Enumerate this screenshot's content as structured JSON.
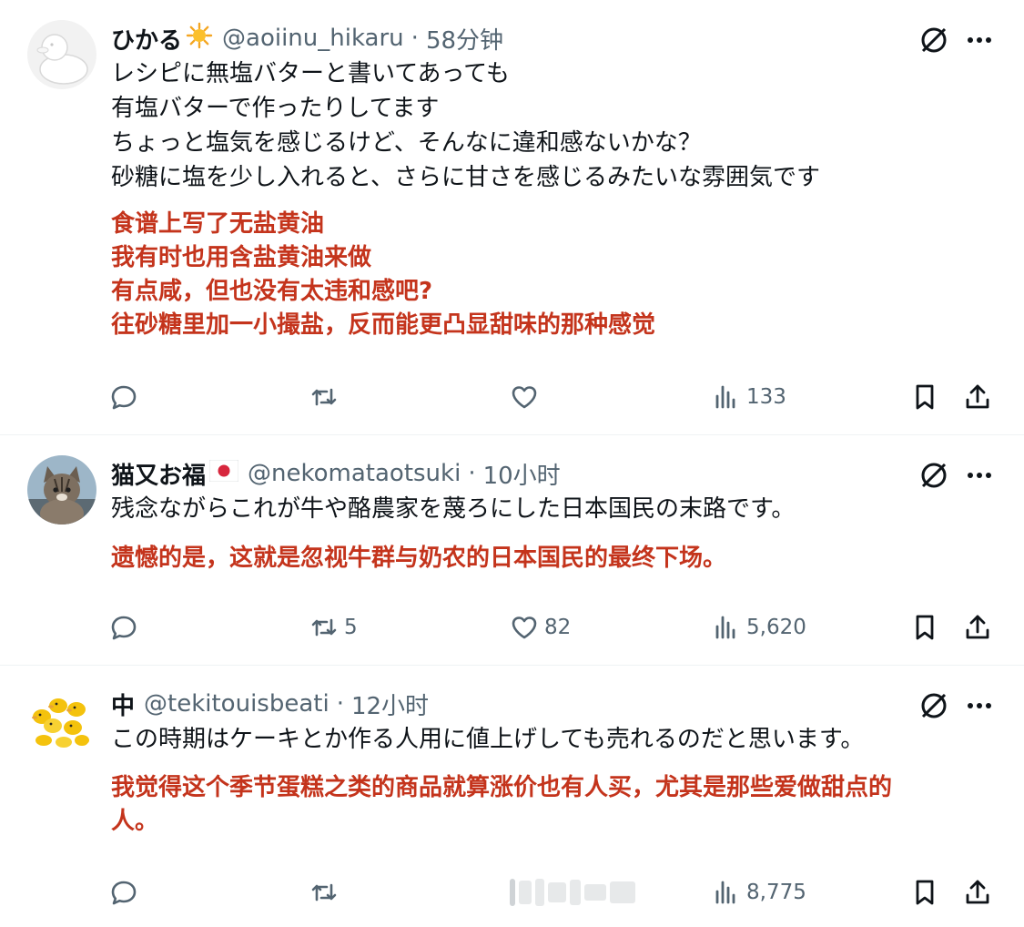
{
  "tweets": [
    {
      "name": "ひかる",
      "badge": "sun-emoji",
      "handle": "@aoiinu_hikaru",
      "sep": "·",
      "time": "58分钟",
      "text_lines": [
        "レシピに無塩バターと書いてあっても",
        "有塩バターで作ったりしてます",
        "ちょっと塩気を感じるけど、そんなに違和感ないかな？",
        "砂糖に塩を少し入れると、さらに甘さを感じるみたいな雰囲気です"
      ],
      "translation_lines": [
        "食谱上写了无盐黄油",
        "我有时也用含盐黄油来做",
        "有点咸，但也没有太违和感吧?",
        "往砂糖里加一小撮盐，反而能更凸显甜味的那种感觉"
      ],
      "replies": "",
      "retweets": "",
      "likes": "",
      "views": "133"
    },
    {
      "name": "猫又お福",
      "badge": "japan-flag",
      "handle": "@nekomataotsuki",
      "sep": "·",
      "time": "10小时",
      "text_lines": [
        "残念ながらこれが牛や酪農家を蔑ろにした日本国民の末路です。"
      ],
      "translation_lines": [
        "遗憾的是，这就是忽视牛群与奶农的日本国民的最终下场。"
      ],
      "replies": "",
      "retweets": "5",
      "likes": "82",
      "views": "5,620"
    },
    {
      "name": "中",
      "badge": "",
      "handle": "@tekitouisbeati",
      "sep": "·",
      "time": "12小时",
      "text_lines": [
        "この時期はケーキとか作る人用に値上げしても売れるのだと思います。"
      ],
      "translation_lines": [
        "我觉得这个季节蛋糕之类的商品就算涨价也有人买，尤其是那些爱做甜点的",
        "人。"
      ],
      "replies": "",
      "retweets": "",
      "likes": "",
      "views": "8,775"
    }
  ],
  "colors": {
    "text": "#0f1419",
    "secondary": "#536471",
    "translation": "#c4341c",
    "divider": "#eff3f4"
  },
  "icons": [
    "reply-icon",
    "retweet-icon",
    "like-icon",
    "views-icon",
    "bookmark-icon",
    "share-icon",
    "grok-icon",
    "more-icon"
  ]
}
